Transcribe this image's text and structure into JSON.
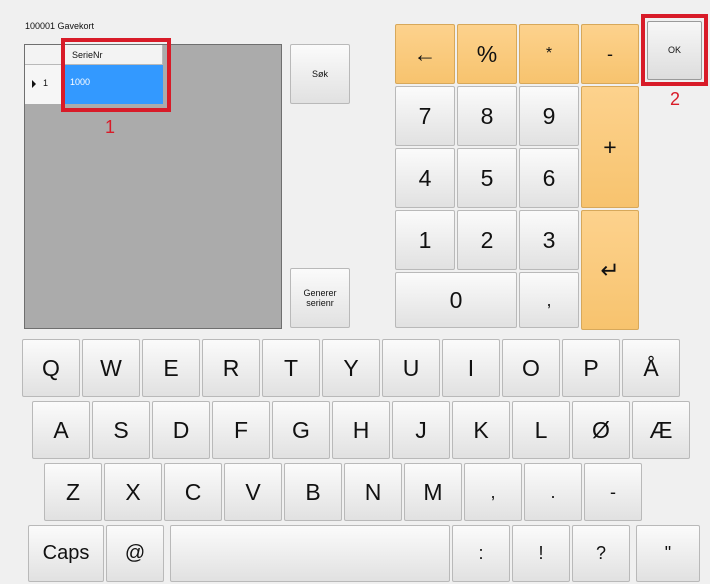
{
  "window": {
    "title": "100001 Gavekort"
  },
  "grid": {
    "column_header": "SerieNr",
    "row_number": "1",
    "selected_value": "1000"
  },
  "annotations": {
    "callout_1": "1",
    "callout_2": "2"
  },
  "side_buttons": {
    "search": "Søk",
    "generate_serial": "Generer\nserienr"
  },
  "keypad": {
    "backspace_icon": "←",
    "percent": "%",
    "asterisk": "*",
    "minus": "-",
    "ok": "OK",
    "seven": "7",
    "eight": "8",
    "nine": "9",
    "plus": "+",
    "four": "4",
    "five": "5",
    "six": "6",
    "one": "1",
    "two": "2",
    "three": "3",
    "enter_icon": "↵",
    "zero": "0",
    "comma": ","
  },
  "keyboard": {
    "row1": [
      "Q",
      "W",
      "E",
      "R",
      "T",
      "Y",
      "U",
      "I",
      "O",
      "P",
      "Å"
    ],
    "row2": [
      "A",
      "S",
      "D",
      "F",
      "G",
      "H",
      "J",
      "K",
      "L",
      "Ø",
      "Æ"
    ],
    "row3": [
      "Z",
      "X",
      "C",
      "V",
      "B",
      "N",
      "M",
      ",",
      ".",
      "-"
    ],
    "row4": {
      "caps": "Caps",
      "at": "@",
      "colon": ":",
      "exclamation": "!",
      "question": "?",
      "quote": "\""
    }
  },
  "colors": {
    "accent_orange": "#f7c36e",
    "selection_blue": "#3399ff",
    "annotation_red": "#d81b28"
  }
}
